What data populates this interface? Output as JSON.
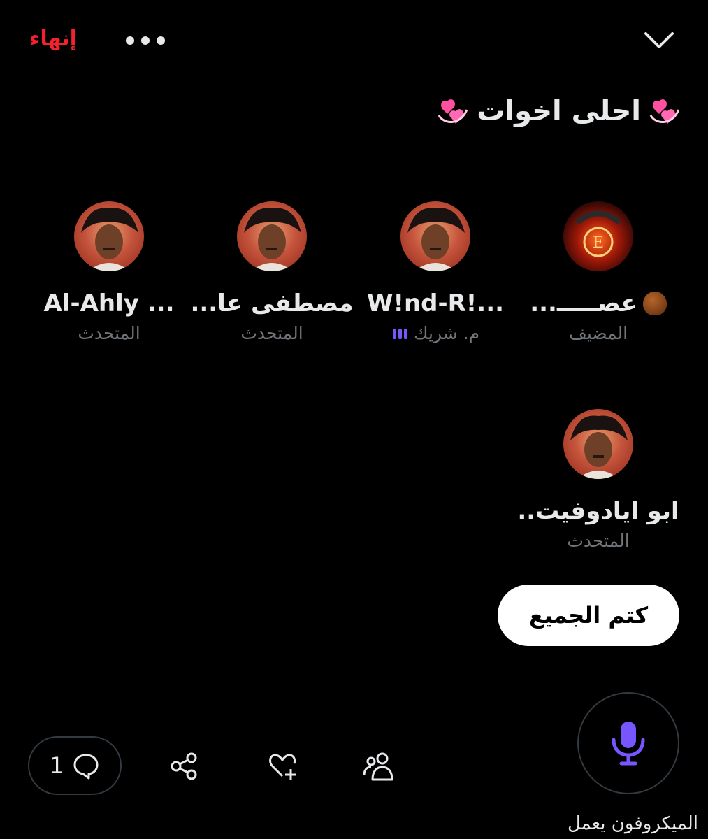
{
  "header": {
    "end_label": "إنهاء",
    "more_icon": "more-horizontal-icon",
    "collapse_icon": "chevron-down-icon"
  },
  "space": {
    "title": "احلى اخوات",
    "title_emoji": "💞"
  },
  "speakers": [
    {
      "name": "عصـــــ...",
      "name_emoji": "🌰",
      "role": "المضيف",
      "avatar": "dragon-emblem-avatar"
    },
    {
      "name": "W!nd-R!...",
      "role": "م. شريك",
      "speaking": true,
      "avatar": "man-photo-avatar"
    },
    {
      "name": "مصطفى عا...",
      "role": "المتحدث",
      "avatar": "man-photo-avatar"
    },
    {
      "name": "Al-Ahly ...",
      "role": "المتحدث",
      "avatar": "man-photo-avatar"
    },
    {
      "name": "ابو ايادوفيت..",
      "role": "المتحدث",
      "avatar": "man-photo-avatar"
    }
  ],
  "mute_all_label": "كتم الجميع",
  "footer": {
    "comments_count": "1",
    "mic_label": "الميكروفون يعمل"
  },
  "colors": {
    "background": "#000000",
    "end_red": "#f4212e",
    "accent_purple": "#7856ff",
    "muted_text": "#71767b"
  }
}
